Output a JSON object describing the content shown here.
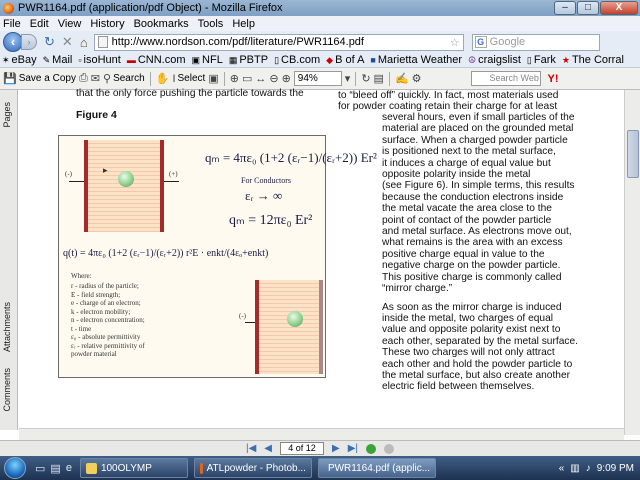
{
  "window": {
    "title": "PWR1164.pdf (application/pdf Object) - Mozilla Firefox",
    "controls": {
      "minimize": "–",
      "maximize": "□",
      "close": "X"
    }
  },
  "menu": {
    "items": [
      "File",
      "Edit",
      "View",
      "History",
      "Bookmarks",
      "Tools",
      "Help"
    ]
  },
  "nav": {
    "url": "http://www.nordson.com/pdf/literature/PWR1164.pdf",
    "search_placeholder": "Google"
  },
  "bookmarks": [
    "eBay",
    "Mail",
    "isoHunt",
    "CNN.com",
    "NFL",
    "PBTP",
    "CB.com",
    "B of A",
    "Marietta Weather",
    "craigslist",
    "Fark",
    "The Corral"
  ],
  "pdf_toolbar": {
    "save_copy": "Save a Copy",
    "search": "Search",
    "select": "Select",
    "zoom": "94%",
    "search_web_placeholder": "Search Web"
  },
  "side_tabs": {
    "pages": "Pages",
    "attachments": "Attachments",
    "comments": "Comments"
  },
  "document": {
    "top_left_line": "that the only force pushing the particle towards the",
    "figure_label": "Figure 4",
    "right_column_top": [
      "to “bleed off” quickly. In fact, most materials used",
      "for powder coating retain their charge for at least"
    ],
    "right_column": [
      "several hours, even if small particles of the",
      "material are placed on the grounded metal",
      "surface. When a charged powder particle",
      "is positioned next to the metal surface,",
      "it induces a charge of equal value but",
      "opposite polarity inside the metal",
      "(see Figure 6). In simple terms, this results",
      "because the conduction electrons inside",
      "the metal vacate the area close to the",
      "point of contact of the powder particle",
      "and metal surface. As electrons move out,",
      "what remains is the area with an excess",
      "positive charge equal in value to the",
      "negative charge on the powder particle.",
      "This positive charge is commonly called",
      "“mirror charge.”",
      "",
      "As soon as the mirror charge is induced",
      "inside the metal, two charges of equal",
      "value and opposite polarity exist next to",
      "each other, separated by the metal surface.",
      "These two charges will not only attract",
      "each other and hold the powder particle to",
      "the metal surface, but also create another",
      "electric field between themselves."
    ],
    "figure": {
      "eq1": "qₘ = 4πε₀ (1+2 (εᵣ−1)/(εᵣ+2)) Er²",
      "for_conductors": "For Conductors",
      "limit": "εᵣ → ∞",
      "eq2": "qₘ = 12πε₀ Er²",
      "eq3": "q(t) = 4πε₀ (1+2 (εᵣ−1)/(εᵣ+2)) r²E · enkt/(4εₒ+enkt)",
      "minus_label": "(-)",
      "plus_label": "(+)",
      "where": "Where:",
      "legend": [
        "r  - radius of the particle;",
        "E  - field strength;",
        "e  - charge of an electron;",
        "k  - electron mobility;",
        "n  - electron concentration;",
        "t  - time",
        "ε₀ - absolute permittivity",
        "εᵣ - relative permittivity of",
        "      powder material"
      ]
    }
  },
  "pager": {
    "page": "4 of 12"
  },
  "taskbar": {
    "tasks": [
      "100OLYMP",
      "ATLpowder - Photob...",
      "PWR1164.pdf (applic..."
    ],
    "time": "9:09 PM"
  }
}
